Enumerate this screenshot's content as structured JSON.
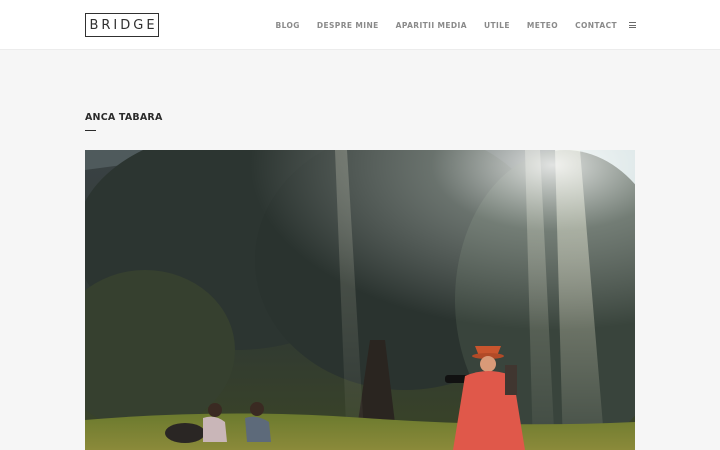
{
  "header": {
    "logo_text": "BRIDGE",
    "nav": [
      {
        "label": "BLOG"
      },
      {
        "label": "DESPRE MINE"
      },
      {
        "label": "APARITII MEDIA"
      },
      {
        "label": "UTILE"
      },
      {
        "label": "METEO"
      },
      {
        "label": "CONTACT"
      }
    ],
    "menu_icon": "hamburger-menu-icon"
  },
  "main": {
    "title": "ANCA TABARA",
    "photo": {
      "subject": "forest-clearing-photo"
    }
  },
  "colors": {
    "page_background": "#f6f6f6",
    "header_background": "#ffffff",
    "nav_text": "#8a8a8a",
    "title_text": "#2b2b2b"
  }
}
